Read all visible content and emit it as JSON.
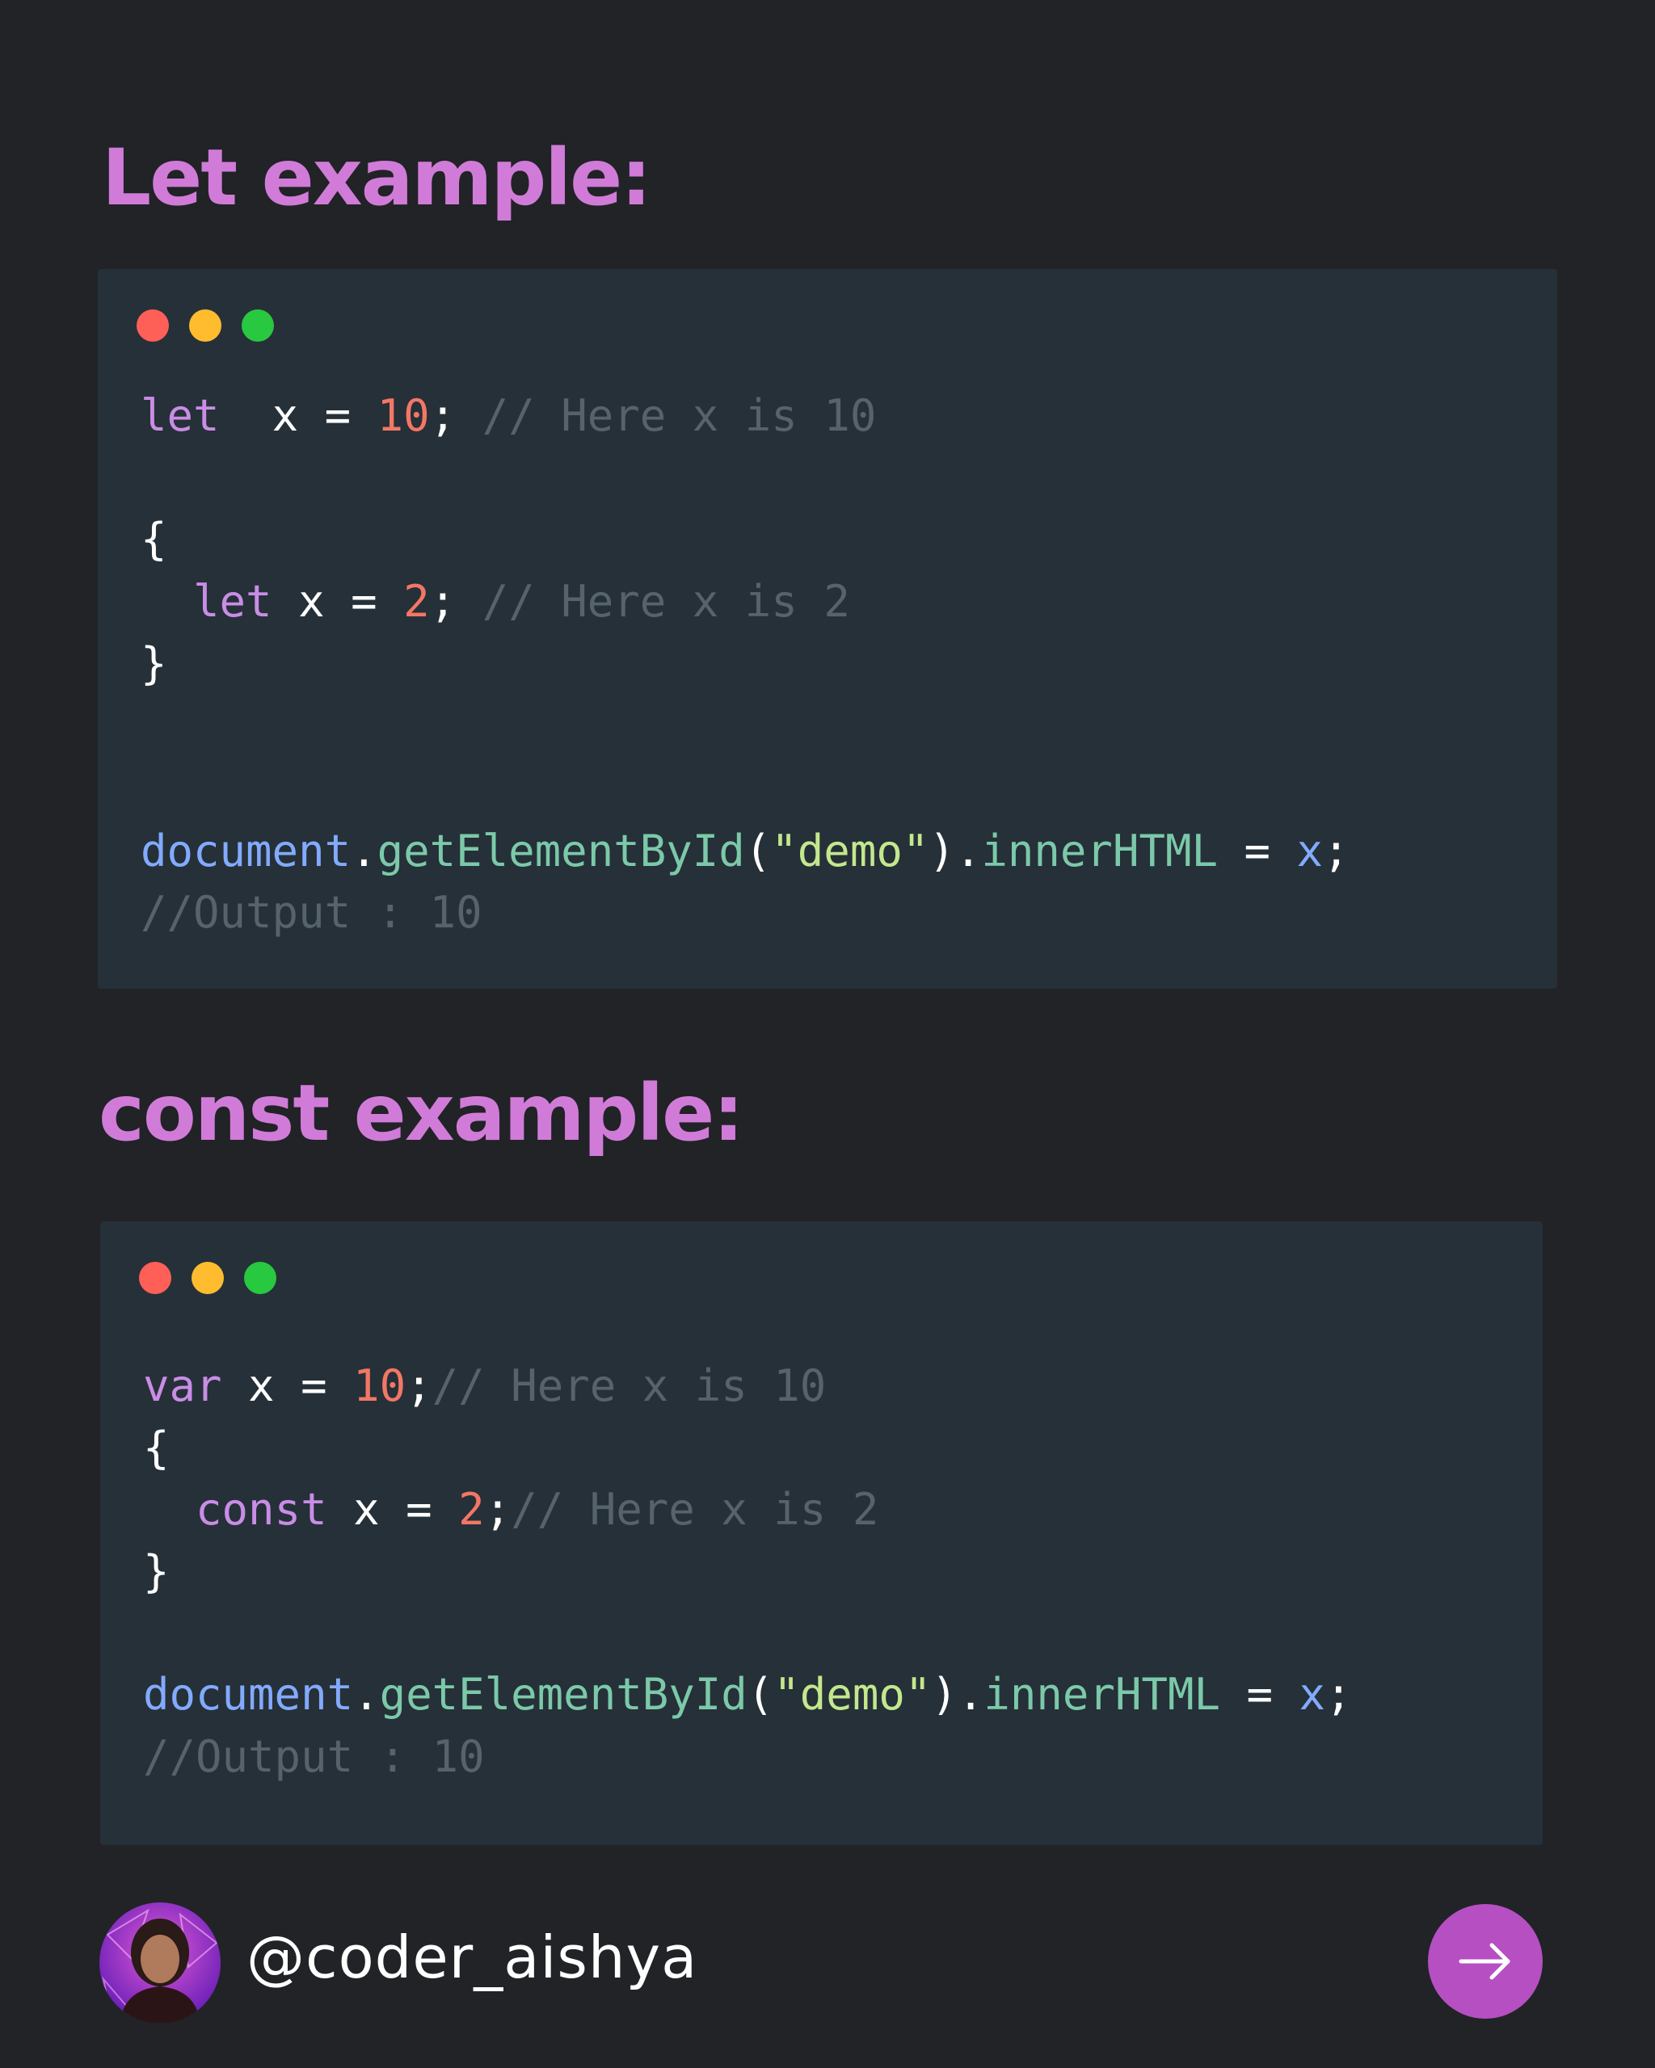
{
  "sections": [
    {
      "heading": "Let example:",
      "lines": [
        [
          [
            "kw",
            "let"
          ],
          [
            "pun",
            "  x = "
          ],
          [
            "num",
            "10"
          ],
          [
            "pun",
            "; "
          ],
          [
            "cmt",
            "// Here x is 10"
          ]
        ],
        [
          [
            "pun",
            "{"
          ]
        ],
        [
          [
            "pun",
            "  "
          ],
          [
            "kw",
            "let"
          ],
          [
            "pun",
            " x = "
          ],
          [
            "num",
            "2"
          ],
          [
            "pun",
            "; "
          ],
          [
            "cmt",
            "// Here x is 2"
          ]
        ],
        [
          [
            "pun",
            "}"
          ]
        ],
        [
          [
            "obj",
            "document"
          ],
          [
            "pun",
            "."
          ],
          [
            "fn",
            "getElementById"
          ],
          [
            "pun",
            "("
          ],
          [
            "str",
            "\"demo\""
          ],
          [
            "pun",
            ")."
          ],
          [
            "fn",
            "innerHTML"
          ],
          [
            "pun",
            " = "
          ],
          [
            "var",
            "x"
          ],
          [
            "pun",
            ";"
          ]
        ],
        [
          [
            "cmt",
            "//Output : 10"
          ]
        ]
      ]
    },
    {
      "heading": "const example:",
      "lines": [
        [
          [
            "kw",
            "var"
          ],
          [
            "pun",
            " x = "
          ],
          [
            "num",
            "10"
          ],
          [
            "pun",
            ";"
          ],
          [
            "cmt",
            "// Here x is 10"
          ]
        ],
        [
          [
            "pun",
            "{"
          ]
        ],
        [
          [
            "pun",
            "  "
          ],
          [
            "kw",
            "const"
          ],
          [
            "pun",
            " x = "
          ],
          [
            "num",
            "2"
          ],
          [
            "pun",
            ";"
          ],
          [
            "cmt",
            "// Here x is 2"
          ]
        ],
        [
          [
            "pun",
            "}"
          ]
        ],
        [
          [
            "obj",
            "document"
          ],
          [
            "pun",
            "."
          ],
          [
            "fn",
            "getElementById"
          ],
          [
            "pun",
            "("
          ],
          [
            "str",
            "\"demo\""
          ],
          [
            "pun",
            ")."
          ],
          [
            "fn",
            "innerHTML"
          ],
          [
            "pun",
            " = "
          ],
          [
            "var",
            "x"
          ],
          [
            "pun",
            ";"
          ]
        ],
        [
          [
            "cmt",
            "//Output : 10"
          ]
        ]
      ]
    }
  ],
  "window_controls": [
    "close-dot",
    "minimize-dot",
    "maximize-dot"
  ],
  "footer": {
    "handle": "@coder_aishya",
    "avatar": "profile-photo",
    "next_icon": "arrow-right-icon"
  },
  "colors": {
    "background": "#212327",
    "code_background": "#263038",
    "heading": "#d17bd8",
    "keyword": "#c98de6",
    "number": "#f37765",
    "comment": "#56636c",
    "object": "#82aaff",
    "function": "#7bc9a9",
    "string": "#c3e88d",
    "button": "#b64fc1"
  }
}
